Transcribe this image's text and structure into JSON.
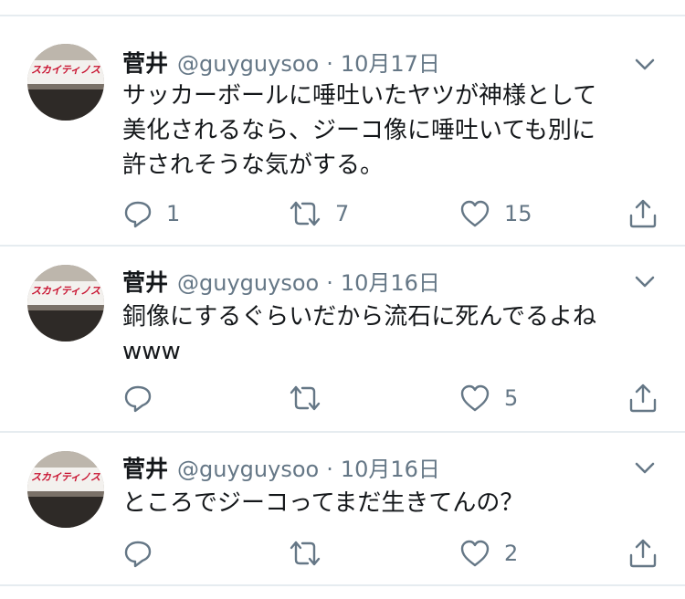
{
  "tweets": [
    {
      "name": "菅井",
      "handle": "@guyguysoo",
      "separator": "·",
      "date": "10月17日",
      "text": "サッカーボールに唾吐いたヤツが神様として\n美化されるなら、ジーコ像に唾吐いても別に\n許されそうな気がする。",
      "reply_count": "1",
      "retweet_count": "7",
      "like_count": "15",
      "avatar_sign": "スカイティノス"
    },
    {
      "name": "菅井",
      "handle": "@guyguysoo",
      "separator": "·",
      "date": "10月16日",
      "text": "銅像にするぐらいだから流石に死んでるよね\nwww",
      "reply_count": "",
      "retweet_count": "",
      "like_count": "5",
      "avatar_sign": "スカイティノス"
    },
    {
      "name": "菅井",
      "handle": "@guyguysoo",
      "separator": "·",
      "date": "10月16日",
      "text": "ところでジーコってまだ生きてんの？",
      "reply_count": "",
      "retweet_count": "",
      "like_count": "2",
      "avatar_sign": "スカイティノス"
    }
  ],
  "colors": {
    "text_primary": "#14171a",
    "text_secondary": "#657786",
    "divider": "#e6ecf0",
    "icon": "#657786",
    "avatar_sign_red": "#c8102e"
  },
  "icons": [
    "reply-icon",
    "retweet-icon",
    "like-icon",
    "share-icon",
    "chevron-down-icon"
  ]
}
